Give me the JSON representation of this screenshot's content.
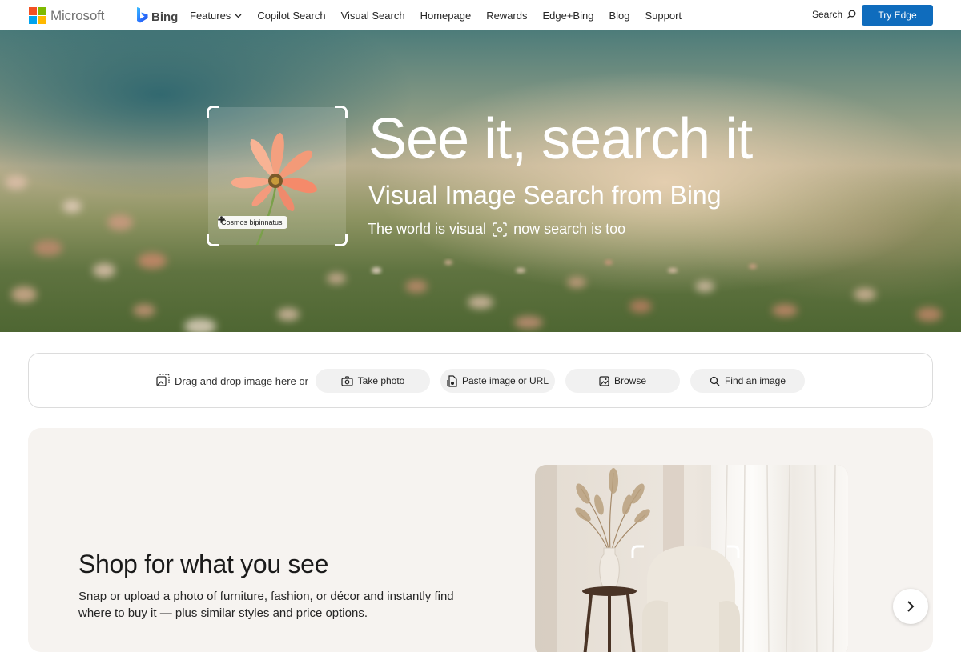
{
  "nav": {
    "brand": "Microsoft",
    "product": "Bing",
    "links": [
      {
        "label": "Features",
        "has_dropdown": true
      },
      {
        "label": "Copilot Search"
      },
      {
        "label": "Visual Search"
      },
      {
        "label": "Homepage"
      },
      {
        "label": "Rewards"
      },
      {
        "label": "Edge+Bing"
      },
      {
        "label": "Blog"
      },
      {
        "label": "Support"
      }
    ],
    "search_label": "Search",
    "cta_label": "Try Edge",
    "colors": {
      "cta": "#0f6cbd",
      "ms_red": "#f25022",
      "ms_green": "#7fba00",
      "ms_blue": "#00a4ef",
      "ms_yellow": "#ffb900"
    }
  },
  "hero": {
    "title": "See it, search it",
    "subtitle": "Visual Image Search from Bing",
    "tagline_left": "The world is visual",
    "tagline_right": "now search is too",
    "image_tag": "Cosmos bipinnatus"
  },
  "search_bar": {
    "drop_text": "Drag and drop image here or",
    "buttons": [
      {
        "label": "Take photo",
        "icon": "camera-icon"
      },
      {
        "label": "Paste image or URL",
        "icon": "paste-icon"
      },
      {
        "label": "Browse",
        "icon": "image-icon"
      },
      {
        "label": "Find an image",
        "icon": "search-icon"
      }
    ]
  },
  "shop": {
    "title": "Shop for what you see",
    "description": "Snap or upload a photo of furniture, fashion, or décor and instantly find where to buy it — plus similar styles and price options."
  }
}
